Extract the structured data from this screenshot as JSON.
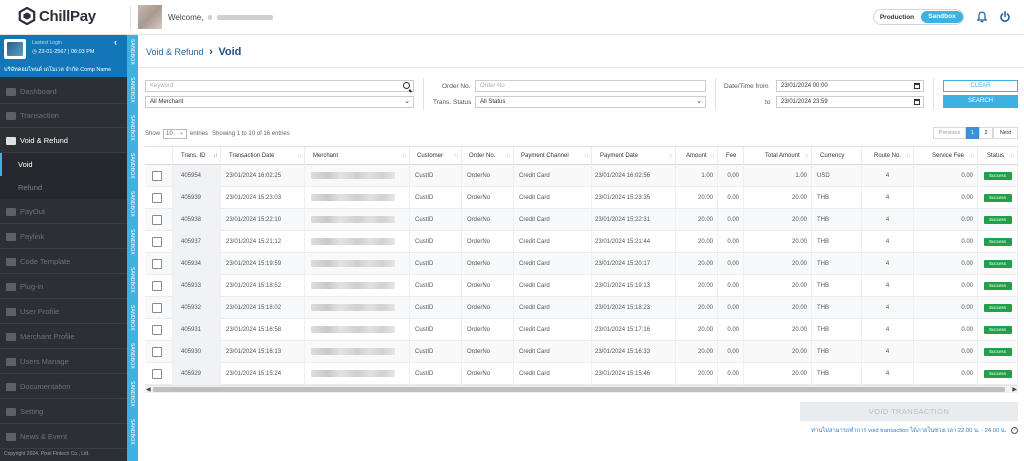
{
  "header": {
    "app_name": "ChillPay",
    "welcome": "Welcome,",
    "env_production": "Production",
    "env_sandbox": "Sandbox",
    "icons": [
      "bell-icon",
      "power-icon"
    ],
    "accent": "#3db1e2"
  },
  "sidebar": {
    "last_login_label": "Lastest Login",
    "last_login_time": "23-01-2567 | 06:03 PM",
    "company": "บริษัทคอมไพนด์ เดโมเวล จำกัด Comp Name",
    "items": [
      {
        "label": "Dashboard",
        "icon": "chart-icon"
      },
      {
        "label": "Transaction",
        "icon": "list-icon"
      },
      {
        "label": "Void & Refund",
        "icon": "card-icon"
      },
      {
        "label": "PayOut",
        "icon": "payout-icon"
      },
      {
        "label": "Paylink",
        "icon": "link-icon"
      },
      {
        "label": "Code Template",
        "icon": "code-icon"
      },
      {
        "label": "Plug-in",
        "icon": "plug-icon"
      },
      {
        "label": "User Profile",
        "icon": "user-icon"
      },
      {
        "label": "Merchant Profile",
        "icon": "users-icon"
      },
      {
        "label": "Users Manage",
        "icon": "users-manage-icon"
      },
      {
        "label": "Documentation",
        "icon": "folder-icon"
      },
      {
        "label": "Setting",
        "icon": "gear-icon"
      },
      {
        "label": "News & Event",
        "icon": "news-icon"
      }
    ],
    "sub_items": [
      "Void",
      "Refund"
    ],
    "copyright": "Copyright 2024. Pixel Fintech Co., Ltd."
  },
  "sandbox_stripe": "SANDBOX",
  "breadcrumb": {
    "parent": "Void & Refund",
    "current": "Void"
  },
  "filters": {
    "keyword_placeholder": "Keyword",
    "merchant_value": "All Merchant",
    "order_no_label": "Order No.",
    "order_no_placeholder": "Order No",
    "trans_status_label": "Trans. Status",
    "trans_status_value": "All Status",
    "date_from_label": "Date/Time from",
    "date_from_value": "23/01/2024 00:00",
    "date_to_label": "to",
    "date_to_value": "23/01/2024 23:59",
    "clear_label": "CLEAR",
    "search_label": "SEARCH"
  },
  "table_info": {
    "show": "Show",
    "page_size": "10",
    "entries": "entries",
    "showing": "Showing 1 to 10 of 16 entries",
    "prev": "Previous",
    "pages": [
      "1",
      "2"
    ],
    "next": "Next"
  },
  "table": {
    "columns": [
      "Trans. ID",
      "Transaction Date",
      "Merchant",
      "Customer",
      "Order No.",
      "Payment Channel",
      "Payment Date",
      "Amount",
      "Fee",
      "Total Amount",
      "Currency",
      "Route No.",
      "Service Fee",
      "Status"
    ],
    "rows": [
      {
        "id": "405954",
        "date": "23/01/2024 16:02:25",
        "customer": "CustID",
        "order": "OrderNo",
        "channel": "Credit Card",
        "pay_date": "23/01/2024 16:02:56",
        "amount": "1.00",
        "fee": "0.00",
        "total": "1.00",
        "currency": "USD",
        "route": "4",
        "service_fee": "0.00",
        "status": "Success"
      },
      {
        "id": "405939",
        "date": "23/01/2024 15:23:03",
        "customer": "CustID",
        "order": "OrderNo",
        "channel": "Credit Card",
        "pay_date": "23/01/2024 15:23:35",
        "amount": "20.00",
        "fee": "0.00",
        "total": "20.00",
        "currency": "THB",
        "route": "4",
        "service_fee": "0.00",
        "status": "Success"
      },
      {
        "id": "405938",
        "date": "23/01/2024 15:22:10",
        "customer": "CustID",
        "order": "OrderNo",
        "channel": "Credit Card",
        "pay_date": "23/01/2024 15:22:31",
        "amount": "20.00",
        "fee": "0.00",
        "total": "20.00",
        "currency": "THB",
        "route": "4",
        "service_fee": "0.00",
        "status": "Success"
      },
      {
        "id": "405937",
        "date": "23/01/2024 15:21:12",
        "customer": "CustID",
        "order": "OrderNo",
        "channel": "Credit Card",
        "pay_date": "23/01/2024 15:21:44",
        "amount": "20.00",
        "fee": "0.00",
        "total": "20.00",
        "currency": "THB",
        "route": "4",
        "service_fee": "0.00",
        "status": "Success"
      },
      {
        "id": "405934",
        "date": "23/01/2024 15:19:59",
        "customer": "CustID",
        "order": "OrderNo",
        "channel": "Credit Card",
        "pay_date": "23/01/2024 15:20:17",
        "amount": "20.00",
        "fee": "0.00",
        "total": "20.00",
        "currency": "THB",
        "route": "4",
        "service_fee": "0.00",
        "status": "Success"
      },
      {
        "id": "405933",
        "date": "23/01/2024 15:18:52",
        "customer": "CustID",
        "order": "OrderNo",
        "channel": "Credit Card",
        "pay_date": "23/01/2024 15:19:13",
        "amount": "20.00",
        "fee": "0.00",
        "total": "20.00",
        "currency": "THB",
        "route": "4",
        "service_fee": "0.00",
        "status": "Success"
      },
      {
        "id": "405932",
        "date": "23/01/2024 15:18:02",
        "customer": "CustID",
        "order": "OrderNo",
        "channel": "Credit Card",
        "pay_date": "23/01/2024 15:18:23",
        "amount": "20.00",
        "fee": "0.00",
        "total": "20.00",
        "currency": "THB",
        "route": "4",
        "service_fee": "0.00",
        "status": "Success"
      },
      {
        "id": "405931",
        "date": "23/01/2024 15:16:58",
        "customer": "CustID",
        "order": "OrderNo",
        "channel": "Credit Card",
        "pay_date": "23/01/2024 15:17:16",
        "amount": "20.00",
        "fee": "0.00",
        "total": "20.00",
        "currency": "THB",
        "route": "4",
        "service_fee": "0.00",
        "status": "Success"
      },
      {
        "id": "405930",
        "date": "23/01/2024 15:16:13",
        "customer": "CustID",
        "order": "OrderNo",
        "channel": "Credit Card",
        "pay_date": "23/01/2024 15:16:33",
        "amount": "20.00",
        "fee": "0.00",
        "total": "20.00",
        "currency": "THB",
        "route": "4",
        "service_fee": "0.00",
        "status": "Success"
      },
      {
        "id": "405929",
        "date": "23/01/2024 15:15:24",
        "customer": "CustID",
        "order": "OrderNo",
        "channel": "Credit Card",
        "pay_date": "23/01/2024 15:15:46",
        "amount": "20.00",
        "fee": "0.00",
        "total": "20.00",
        "currency": "THB",
        "route": "4",
        "service_fee": "0.00",
        "status": "Success"
      }
    ],
    "status_color": "#21a04b"
  },
  "actions": {
    "void_label": "VOID TRANSACTION",
    "note": "ท่านไม่สามารถทำการ void transaction ได้ภายในช่วงเวลา 22.00 น. - 24.00 น.",
    "help_glyph": "?"
  }
}
